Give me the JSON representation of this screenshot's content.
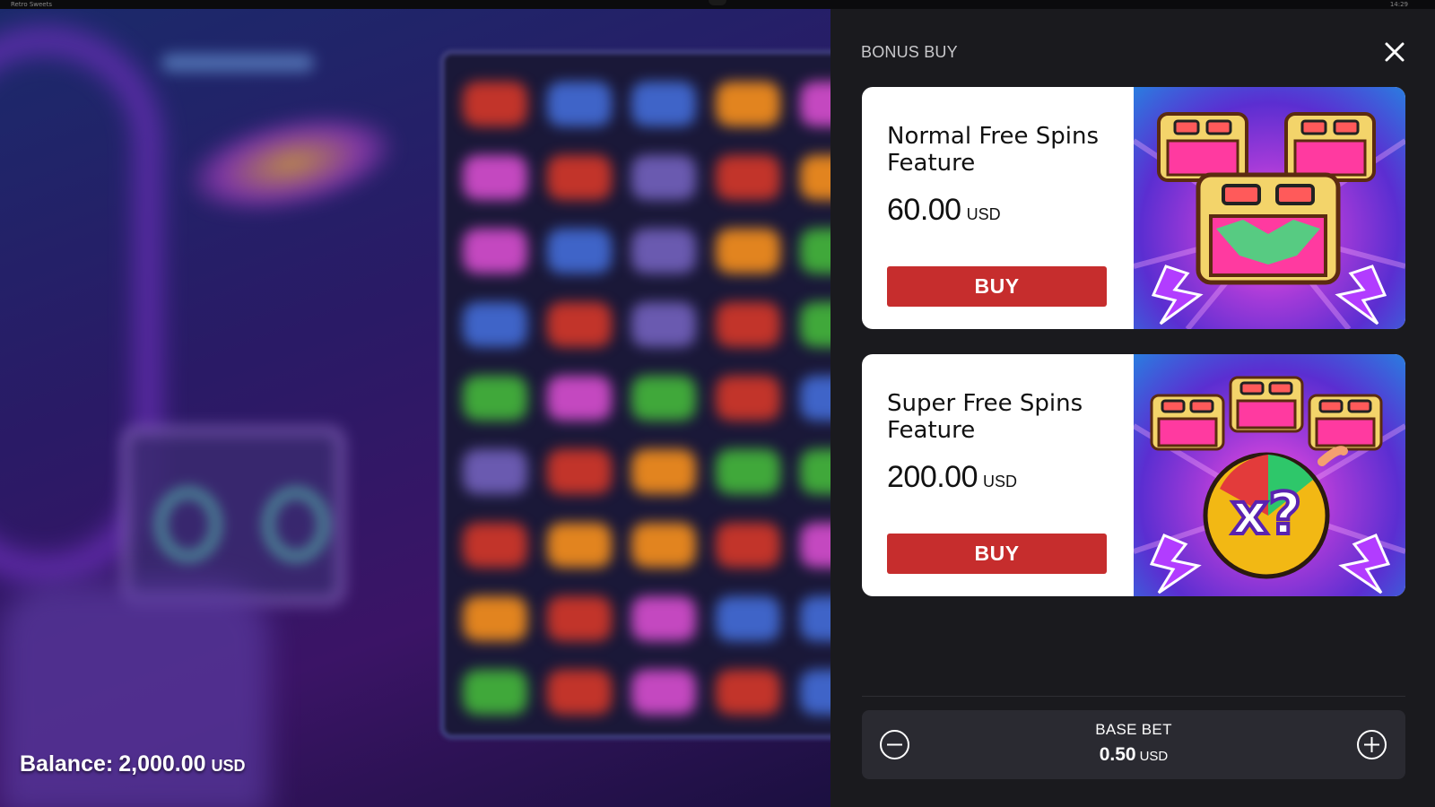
{
  "system_bar": {
    "app_title": "Retro Sweets",
    "clock": "14:29"
  },
  "panel": {
    "title": "BONUS BUY",
    "close_icon": "close-icon"
  },
  "features": [
    {
      "name": "Normal Free Spins Feature",
      "price": "60.00",
      "currency": "USD",
      "buy_label": "BUY"
    },
    {
      "name": "Super Free Spins Feature",
      "price": "200.00",
      "currency": "USD",
      "buy_label": "BUY",
      "art_text": "x?"
    }
  ],
  "bet": {
    "label": "BASE BET",
    "value": "0.50",
    "currency": "USD",
    "decrease_icon": "minus-circle-icon",
    "increase_icon": "plus-circle-icon"
  },
  "balance": {
    "label": "Balance:",
    "value": "2,000.00",
    "currency": "USD"
  },
  "colors": {
    "panel_bg": "#1a1a1e",
    "buy_button": "#c62d2d",
    "card_bg": "#ffffff",
    "bet_bar_bg": "#2a2a31"
  }
}
